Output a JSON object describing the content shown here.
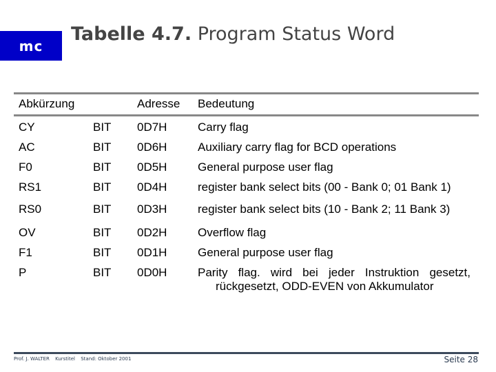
{
  "header": {
    "logo": "mc",
    "title_bold": "Tabelle 4.7.",
    "title_rest": " Program Status Word"
  },
  "table": {
    "headers": {
      "abbreviation": "Abkürzung",
      "address": "Adresse",
      "meaning": "Bedeutung"
    },
    "rows": [
      {
        "abbr": "CY",
        "type": "BIT",
        "addr": "0D7H",
        "desc": "Carry flag"
      },
      {
        "abbr": "AC",
        "type": "BIT",
        "addr": "0D6H",
        "desc": "Auxiliary carry flag for BCD operations"
      },
      {
        "abbr": "F0",
        "type": "BIT",
        "addr": "0D5H",
        "desc": "General purpose user flag"
      },
      {
        "abbr": "RS1",
        "type": "BIT",
        "addr": "0D4H",
        "desc": "register bank select bits (00 - Bank 0; 01 Bank 1)"
      },
      {
        "abbr": "RS0",
        "type": "BIT",
        "addr": "0D3H",
        "desc": "register bank select bits (10 - Bank 2; 11 Bank 3)"
      },
      {
        "abbr": "OV",
        "type": "BIT",
        "addr": "0D2H",
        "desc": "Overflow flag"
      },
      {
        "abbr": "F1",
        "type": "BIT",
        "addr": "0D1H",
        "desc": "General purpose user flag"
      },
      {
        "abbr": "P",
        "type": "BIT",
        "addr": "0D0H",
        "desc": "Parity flag. wird bei jeder Instruktion gesetzt,",
        "desc_line2": "rückgesetzt, ODD-EVEN von Akkumulator"
      }
    ]
  },
  "footer": {
    "author": "Prof. J. WALTER",
    "course": "Kurstitel",
    "date": "Stand: Oktober 2001",
    "page": "Seite 28"
  },
  "colors": {
    "logo_bg": "#0000c8",
    "title_text": "#444444",
    "table_rule": "#888888",
    "footer": "#3c4a5c"
  }
}
